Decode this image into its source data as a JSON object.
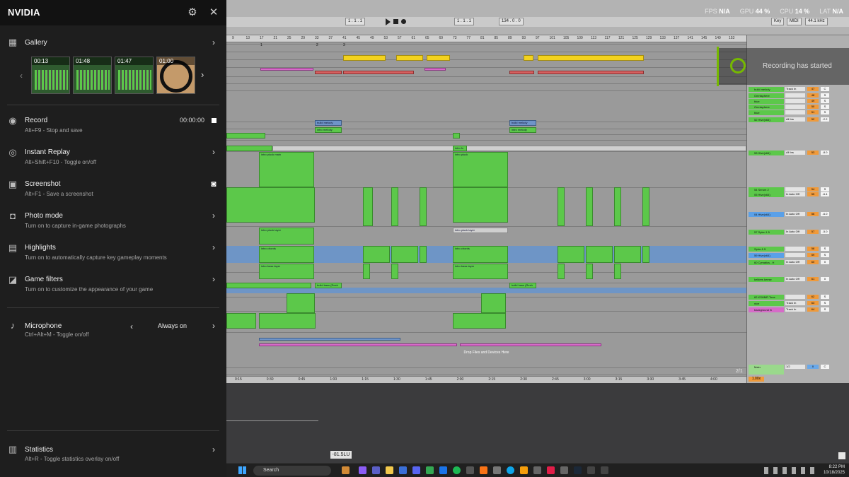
{
  "nvidia": {
    "title": "NVIDIA",
    "gallery": {
      "label": "Gallery",
      "thumbnails": [
        "00:13",
        "01:48",
        "01:47",
        "01:00"
      ]
    },
    "record": {
      "label": "Record",
      "sub": "Alt+F9 - Stop and save",
      "time": "00:00:00"
    },
    "instant_replay": {
      "label": "Instant Replay",
      "sub": "Alt+Shift+F10 - Toggle on/off"
    },
    "screenshot": {
      "label": "Screenshot",
      "sub": "Alt+F1 - Save a screenshot"
    },
    "photo_mode": {
      "label": "Photo mode",
      "sub": "Turn on to capture in-game photographs"
    },
    "highlights": {
      "label": "Highlights",
      "sub": "Turn on to automatically capture key gameplay moments"
    },
    "game_filters": {
      "label": "Game filters",
      "sub": "Turn on to customize the appearance of your game"
    },
    "microphone": {
      "label": "Microphone",
      "sub": "Ctrl+Alt+M - Toggle on/off",
      "value": "Always on"
    },
    "statistics": {
      "label": "Statistics",
      "sub": "Alt+R - Toggle statistics overlay on/off"
    }
  },
  "overlay": {
    "fps_label": "FPS",
    "fps": "N/A",
    "gpu_label": "GPU",
    "gpu": "44 %",
    "cpu_label": "CPU",
    "cpu": "14 %",
    "lat_label": "LAT",
    "lat": "N/A",
    "recording_notice": "Recording has started"
  },
  "daw": {
    "transport": {
      "position": "1 . 1 . 1",
      "loop_start": "1 . 1 . 1",
      "tempo": "134 . 0 . 0",
      "key": "Key",
      "midi": "MIDI",
      "sample_rate": "44.1 kHz"
    },
    "ruler": [
      "9",
      "13",
      "17",
      "21",
      "25",
      "29",
      "33",
      "37",
      "41",
      "45",
      "49",
      "53",
      "57",
      "61",
      "65",
      "69",
      "73",
      "77",
      "81",
      "85",
      "89",
      "93",
      "97",
      "101",
      "105",
      "109",
      "113",
      "117",
      "121",
      "125",
      "129",
      "133",
      "137",
      "141",
      "145",
      "149",
      "153"
    ],
    "locators": [
      "1",
      "2",
      "3"
    ],
    "time_ruler": [
      "0:15",
      "0:30",
      "0:45",
      "1:00",
      "1:15",
      "1:30",
      "1:45",
      "2:00",
      "2:15",
      "2:30",
      "2:45",
      "3:00",
      "3:15",
      "3:30",
      "3:45",
      "4:00"
    ],
    "clip_labels": {
      "build_melody": "build melody",
      "intro_melody": "intro melody",
      "intro_fx": "intro fx",
      "intro_pluck_main": "intro pluck main",
      "intro_pluck": "intro pluck",
      "intro_pluck_layer": "intro pluck layer",
      "intro_chords": "intro chords",
      "intro_bass_layer": "intro bass layer",
      "build_bass": "build bass (Resh"
    },
    "drop_zone": "Drop Files and Devices Here",
    "mixer_tracks": [
      {
        "name": "build melody",
        "input": "Track In",
        "vol": "47",
        "pan": "C"
      },
      {
        "name": "Omnisphere",
        "input": "",
        "vol": "48",
        "pan": "S"
      },
      {
        "name": "blue",
        "input": "",
        "vol": "49",
        "pan": "S"
      },
      {
        "name": "Omnisphere",
        "input": "",
        "vol": "50",
        "pan": "S"
      },
      {
        "name": "blue",
        "input": "",
        "vol": "51",
        "pan": "S"
      },
      {
        "name": "52 Hive(x64)",
        "input": "All Ins",
        "vol": "52",
        "pan": "-2.2"
      },
      {
        "name": "53 Hive(x64)",
        "input": "All Ins",
        "vol": "53",
        "pan": "-8.0"
      },
      {
        "name": "54 Serum 2",
        "input": "",
        "vol": "54",
        "pan": "S"
      },
      {
        "name": "05 Hive(x64)",
        "input": "In Auto Off",
        "vol": "55",
        "pan": "-6.4"
      },
      {
        "name": "04 Hive(x64)",
        "input": "In Auto Off",
        "vol": "56",
        "pan": "-6.0"
      },
      {
        "name": "57 Spire-1.5",
        "input": "In Auto Off",
        "vol": "57",
        "pan": "-5.0"
      },
      {
        "name": "Spire-1.5",
        "input": "",
        "vol": "58",
        "pan": "S"
      },
      {
        "name": "59 Hive(x64)",
        "input": "",
        "vol": "59",
        "pan": "S"
      },
      {
        "name": "60 Cymatics - H",
        "input": "In Auto Off",
        "vol": "60",
        "pan": "0"
      },
      {
        "name": "kelders keese",
        "input": "In Auto Off",
        "vol": "61",
        "pan": "0"
      },
      {
        "name": "62 KSHMR Tone",
        "input": "",
        "vol": "62",
        "pan": "S"
      },
      {
        "name": "nice",
        "input": "Track In",
        "vol": "63",
        "pan": "S"
      },
      {
        "name": "background fx",
        "input": "Track In",
        "vol": "64",
        "pan": "S"
      }
    ],
    "main_track": {
      "name": "Main",
      "out": "1/2",
      "vol": "0",
      "pan": "C"
    },
    "page_indicator": "2/1",
    "zoom": "1.00x",
    "readout": "-81.5LU"
  },
  "taskbar": {
    "search": "Search",
    "time": "8:22 PM",
    "date": "10/18/2025"
  },
  "colors": {
    "nvidia_green": "#76b900",
    "clip_green": "#5cc84a",
    "clip_yellow": "#f3d21e",
    "lane_blue": "#6e95c6"
  }
}
